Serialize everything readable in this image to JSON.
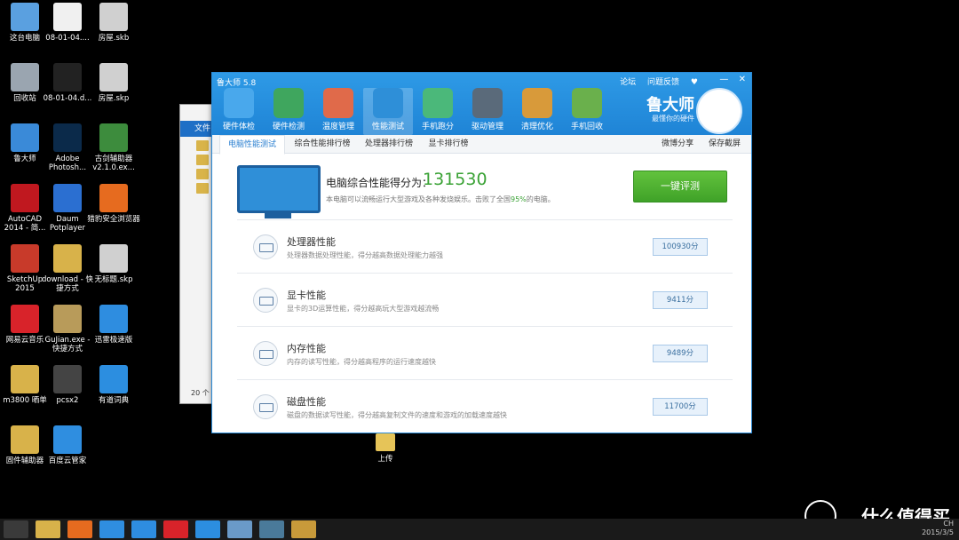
{
  "desktop": {
    "icons": [
      {
        "label": "这台电脑",
        "color": "#5aa0e0"
      },
      {
        "label": "08-01-04....",
        "color": "#f0f0f0"
      },
      {
        "label": "房屋.skb",
        "color": "#d0d0d0"
      },
      {
        "label": "回收站",
        "color": "#9aa5b0"
      },
      {
        "label": "08-01-04.d...",
        "color": "#222"
      },
      {
        "label": "房屋.skp",
        "color": "#d0d0d0"
      },
      {
        "label": "鲁大师",
        "color": "#3a8ad8"
      },
      {
        "label": "Adobe Photosh...",
        "color": "#0b2a4a"
      },
      {
        "label": "古剑辅助器 v2.1.0.ex...",
        "color": "#3d8c3d"
      },
      {
        "label": "AutoCAD 2014 - 简...",
        "color": "#c0181f"
      },
      {
        "label": "Daum Potplayer",
        "color": "#2b6fd1"
      },
      {
        "label": "猎豹安全浏览器",
        "color": "#e66b1f"
      },
      {
        "label": "SketchUp 2015",
        "color": "#c83a2a"
      },
      {
        "label": "download - 快捷方式",
        "color": "#d8b24a"
      },
      {
        "label": "无标题.skp",
        "color": "#d0d0d0"
      },
      {
        "label": "网易云音乐",
        "color": "#d8232a"
      },
      {
        "label": "GuJian.exe - 快捷方式",
        "color": "#b89b5a"
      },
      {
        "label": "迅雷极速版",
        "color": "#2e8de0"
      },
      {
        "label": "m3800 晒单",
        "color": "#d8b24a"
      },
      {
        "label": "pcsx2",
        "color": "#444"
      },
      {
        "label": "有道词典",
        "color": "#2c8ee0"
      },
      {
        "label": "固件辅助器",
        "color": "#d8b24a"
      },
      {
        "label": "百度云管家",
        "color": "#2f8ee0"
      }
    ],
    "upload_folder": "上传"
  },
  "explorer": {
    "tab": "文件",
    "status": "20 个"
  },
  "app": {
    "title": "鲁大师 5.8",
    "links": [
      "论坛",
      "问题反馈",
      "♥"
    ],
    "controls": [
      "—",
      "✕"
    ],
    "brand": "鲁大师",
    "brand_sub": "最懂你的硬件",
    "toolbar": [
      {
        "label": "硬件体检",
        "color": "#49a8ec"
      },
      {
        "label": "硬件检测",
        "color": "#3fa65e"
      },
      {
        "label": "温度管理",
        "color": "#e06a4a"
      },
      {
        "label": "性能测试",
        "color": "#2e8fd8"
      },
      {
        "label": "手机跑分",
        "color": "#4bb87a"
      },
      {
        "label": "驱动管理",
        "color": "#5a6a7a"
      },
      {
        "label": "清理优化",
        "color": "#d89a3a"
      },
      {
        "label": "手机回收",
        "color": "#6ab04c"
      }
    ],
    "tabs": [
      "电脑性能测试",
      "综合性能排行榜",
      "处理器排行榜",
      "显卡排行榜"
    ],
    "tab_actions": [
      "微博分享",
      "保存截屏"
    ],
    "score": {
      "title": "电脑综合性能得分为：",
      "value": "131530",
      "desc_pre": "本电脑可以流畅运行大型游戏及各种发烧娱乐。击败了全国",
      "desc_pct": "95%",
      "desc_post": "的电脑。"
    },
    "bench_button": "一键评测",
    "items": [
      {
        "name": "处理器性能",
        "desc": "处理器数据处理性能，得分越高数据处理能力越强",
        "value": "100930分"
      },
      {
        "name": "显卡性能",
        "desc": "显卡的3D运算性能，得分越高玩大型游戏越流畅",
        "value": "9411分"
      },
      {
        "name": "内存性能",
        "desc": "内存的读写性能，得分越高程序的运行速度越快",
        "value": "9489分"
      },
      {
        "name": "磁盘性能",
        "desc": "磁盘的数据读写性能，得分越高复制文件的速度和游戏的加载速度越快",
        "value": "11700分"
      }
    ]
  },
  "taskbar": {
    "items": [
      {
        "name": "start",
        "color": "#3a3a3a"
      },
      {
        "name": "explorer",
        "color": "#d8b24a"
      },
      {
        "name": "liebao",
        "color": "#e66b1f"
      },
      {
        "name": "baiduyun",
        "color": "#2f8ee0"
      },
      {
        "name": "xunlei",
        "color": "#2e8de0"
      },
      {
        "name": "netease",
        "color": "#d8232a"
      },
      {
        "name": "youdao",
        "color": "#2c8ee0"
      },
      {
        "name": "photos",
        "color": "#6a9ac8"
      },
      {
        "name": "ludashi",
        "color": "#4a7a9a"
      },
      {
        "name": "paint",
        "color": "#c89a3a"
      }
    ],
    "tray_ime": "CH",
    "date": "2015/3/5"
  },
  "watermark": "什么值得买"
}
